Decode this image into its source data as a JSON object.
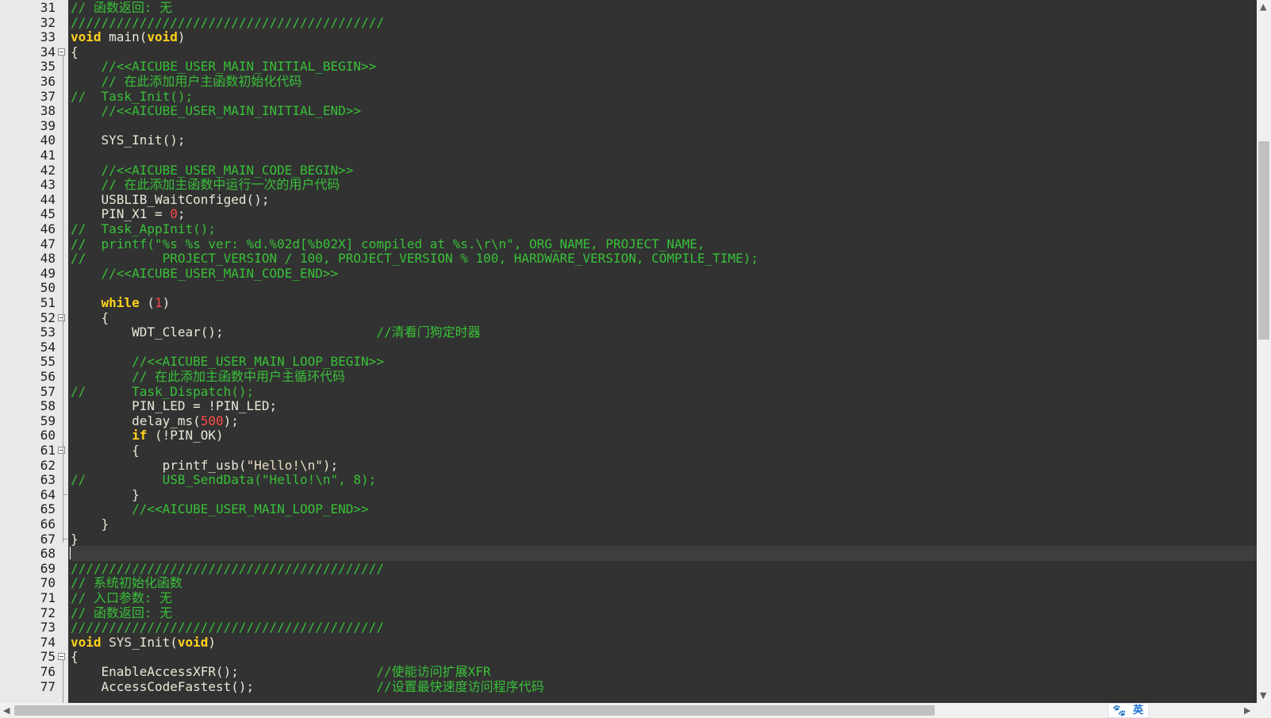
{
  "editor": {
    "lines": [
      {
        "n": "31",
        "parts": [
          [
            "cmt",
            "// 函数返回: 无"
          ]
        ]
      },
      {
        "n": "32",
        "parts": [
          [
            "cmt",
            "/////////////////////////////////////////"
          ]
        ]
      },
      {
        "n": "33",
        "parts": [
          [
            "kw",
            "void"
          ],
          [
            "txt",
            " main("
          ],
          [
            "kw",
            "void"
          ],
          [
            "txt",
            ")"
          ]
        ]
      },
      {
        "n": "34",
        "parts": [
          [
            "txt",
            "{"
          ]
        ]
      },
      {
        "n": "35",
        "parts": [
          [
            "txt",
            "    "
          ],
          [
            "cmt",
            "//<<AICUBE_USER_MAIN_INITIAL_BEGIN>>"
          ]
        ]
      },
      {
        "n": "36",
        "parts": [
          [
            "txt",
            "    "
          ],
          [
            "cmt",
            "// 在此添加用户主函数初始化代码"
          ]
        ]
      },
      {
        "n": "37",
        "parts": [
          [
            "cmt",
            "//  Task_Init();"
          ]
        ]
      },
      {
        "n": "38",
        "parts": [
          [
            "txt",
            "    "
          ],
          [
            "cmt",
            "//<<AICUBE_USER_MAIN_INITIAL_END>>"
          ]
        ]
      },
      {
        "n": "39",
        "parts": []
      },
      {
        "n": "40",
        "parts": [
          [
            "txt",
            "    SYS_Init();"
          ]
        ]
      },
      {
        "n": "41",
        "parts": []
      },
      {
        "n": "42",
        "parts": [
          [
            "txt",
            "    "
          ],
          [
            "cmt",
            "//<<AICUBE_USER_MAIN_CODE_BEGIN>>"
          ]
        ]
      },
      {
        "n": "43",
        "parts": [
          [
            "txt",
            "    "
          ],
          [
            "cmt",
            "// 在此添加主函数中运行一次的用户代码"
          ]
        ]
      },
      {
        "n": "44",
        "parts": [
          [
            "txt",
            "    USBLIB_WaitConfiged();"
          ]
        ]
      },
      {
        "n": "45",
        "parts": [
          [
            "txt",
            "    PIN_X1 = "
          ],
          [
            "num",
            "0"
          ],
          [
            "txt",
            ";"
          ]
        ]
      },
      {
        "n": "46",
        "parts": [
          [
            "cmt",
            "//  Task_AppInit();"
          ]
        ]
      },
      {
        "n": "47",
        "parts": [
          [
            "cmt",
            "//  printf(\"%s %s ver: %d.%02d[%b02X] compiled at %s.\\r\\n\", ORG_NAME, PROJECT_NAME,"
          ]
        ]
      },
      {
        "n": "48",
        "parts": [
          [
            "cmt",
            "//          PROJECT_VERSION / 100, PROJECT_VERSION % 100, HARDWARE_VERSION, COMPILE_TIME);"
          ]
        ]
      },
      {
        "n": "49",
        "parts": [
          [
            "txt",
            "    "
          ],
          [
            "cmt",
            "//<<AICUBE_USER_MAIN_CODE_END>>"
          ]
        ]
      },
      {
        "n": "50",
        "parts": []
      },
      {
        "n": "51",
        "parts": [
          [
            "txt",
            "    "
          ],
          [
            "kw",
            "while"
          ],
          [
            "txt",
            " ("
          ],
          [
            "num",
            "1"
          ],
          [
            "txt",
            ")"
          ]
        ]
      },
      {
        "n": "52",
        "parts": [
          [
            "txt",
            "    {"
          ]
        ]
      },
      {
        "n": "53",
        "parts": [
          [
            "txt",
            "        WDT_Clear();                    "
          ],
          [
            "cmt",
            "//清看门狗定时器"
          ]
        ]
      },
      {
        "n": "54",
        "parts": []
      },
      {
        "n": "55",
        "parts": [
          [
            "txt",
            "        "
          ],
          [
            "cmt",
            "//<<AICUBE_USER_MAIN_LOOP_BEGIN>>"
          ]
        ]
      },
      {
        "n": "56",
        "parts": [
          [
            "txt",
            "        "
          ],
          [
            "cmt",
            "// 在此添加主函数中用户主循环代码"
          ]
        ]
      },
      {
        "n": "57",
        "parts": [
          [
            "cmt",
            "//      Task_Dispatch();"
          ]
        ]
      },
      {
        "n": "58",
        "parts": [
          [
            "txt",
            "        PIN_LED = !PIN_LED;"
          ]
        ]
      },
      {
        "n": "59",
        "parts": [
          [
            "txt",
            "        delay_ms("
          ],
          [
            "num",
            "500"
          ],
          [
            "txt",
            ");"
          ]
        ]
      },
      {
        "n": "60",
        "parts": [
          [
            "txt",
            "        "
          ],
          [
            "kw",
            "if"
          ],
          [
            "txt",
            " (!PIN_OK)"
          ]
        ]
      },
      {
        "n": "61",
        "parts": [
          [
            "txt",
            "        {"
          ]
        ]
      },
      {
        "n": "62",
        "parts": [
          [
            "txt",
            "            printf_usb("
          ],
          [
            "str",
            "\"Hello!\\n\""
          ],
          [
            "txt",
            ");"
          ]
        ]
      },
      {
        "n": "63",
        "parts": [
          [
            "cmt",
            "//          USB_SendData(\"Hello!\\n\", 8);"
          ]
        ]
      },
      {
        "n": "64",
        "parts": [
          [
            "txt",
            "        }"
          ]
        ]
      },
      {
        "n": "65",
        "parts": [
          [
            "txt",
            "        "
          ],
          [
            "cmt",
            "//<<AICUBE_USER_MAIN_LOOP_END>>"
          ]
        ]
      },
      {
        "n": "66",
        "parts": [
          [
            "txt",
            "    }"
          ]
        ]
      },
      {
        "n": "67",
        "parts": [
          [
            "txt",
            "}"
          ]
        ]
      },
      {
        "n": "68",
        "parts": []
      },
      {
        "n": "69",
        "parts": [
          [
            "cmt",
            "/////////////////////////////////////////"
          ]
        ]
      },
      {
        "n": "70",
        "parts": [
          [
            "cmt",
            "// 系统初始化函数"
          ]
        ]
      },
      {
        "n": "71",
        "parts": [
          [
            "cmt",
            "// 入口参数: 无"
          ]
        ]
      },
      {
        "n": "72",
        "parts": [
          [
            "cmt",
            "// 函数返回: 无"
          ]
        ]
      },
      {
        "n": "73",
        "parts": [
          [
            "cmt",
            "/////////////////////////////////////////"
          ]
        ]
      },
      {
        "n": "74",
        "parts": [
          [
            "kw",
            "void"
          ],
          [
            "txt",
            " SYS_Init("
          ],
          [
            "kw",
            "void"
          ],
          [
            "txt",
            ")"
          ]
        ]
      },
      {
        "n": "75",
        "parts": [
          [
            "txt",
            "{"
          ]
        ]
      },
      {
        "n": "76",
        "parts": [
          [
            "txt",
            "    EnableAccessXFR();                  "
          ],
          [
            "cmt",
            "//使能访问扩展XFR"
          ]
        ]
      },
      {
        "n": "77",
        "parts": [
          [
            "txt",
            "    AccessCodeFastest();                "
          ],
          [
            "cmt",
            "//设置最快速度访问程序代码"
          ]
        ]
      }
    ],
    "fold_markers": [
      "34",
      "52",
      "61",
      "75"
    ],
    "fold_ends": [
      "64",
      "67"
    ],
    "current_line": "68"
  },
  "ime": {
    "label": "英"
  },
  "scroll": {
    "left_arrow": "<",
    "right_arrow": ">",
    "up_arrow": "^",
    "down_arrow": "v"
  },
  "colors": {
    "background": "#323232",
    "comment": "#38c038",
    "keyword": "#ffd21a",
    "number": "#ff4a4a",
    "text": "#e8e8d8",
    "gutter": "#e9e9e9"
  }
}
